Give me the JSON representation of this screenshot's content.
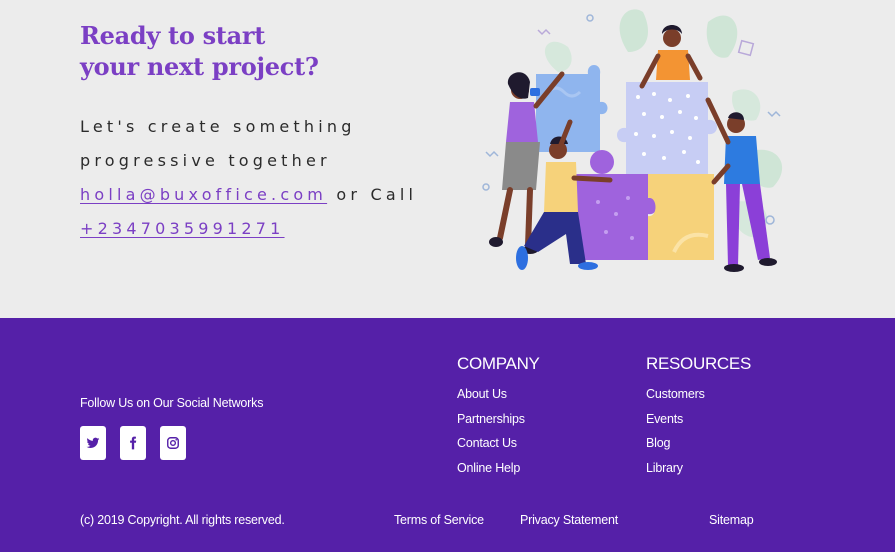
{
  "cta": {
    "title_line1": "Ready to start",
    "title_line2": "your next project?",
    "text_line1": "Let's create something",
    "text_line2": "progressive together",
    "email": "holla@buxoffice.com",
    "or_call": " or Call",
    "phone": "+2347035991271"
  },
  "footer": {
    "follow_text": "Follow Us on Our Social Networks",
    "socials": [
      "twitter-icon",
      "facebook-icon",
      "instagram-icon"
    ],
    "company": {
      "heading": "COMPANY",
      "links": [
        "About Us",
        "Partnerships",
        "Contact Us",
        "Online Help"
      ]
    },
    "resources": {
      "heading": "RESOURCES",
      "links": [
        "Customers",
        "Events",
        "Blog",
        "Library"
      ]
    },
    "copyright": "(c) 2019 Copyright. All rights reserved.",
    "terms": "Terms of Service",
    "privacy": "Privacy Statement",
    "sitemap": "Sitemap"
  },
  "colors": {
    "accent": "#7b3fc4",
    "footer_bg": "#5520a8",
    "page_bg": "#ececec"
  }
}
